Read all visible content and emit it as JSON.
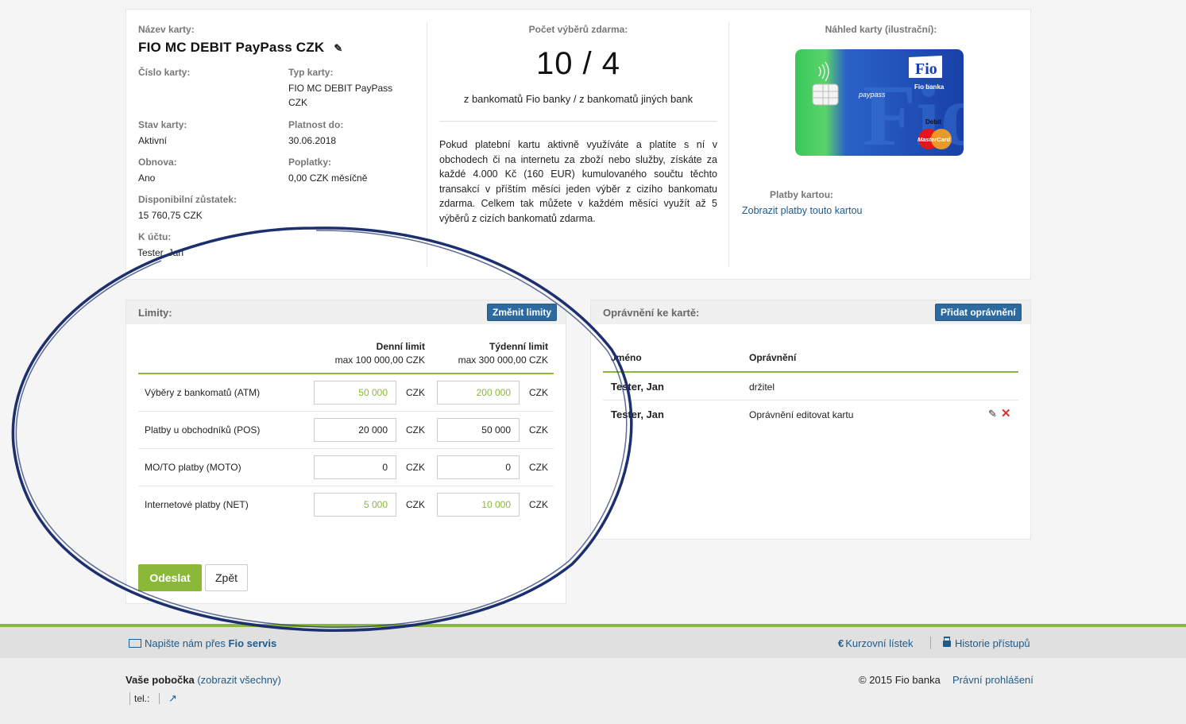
{
  "card": {
    "name_label": "Název karty:",
    "name": "FIO MC DEBIT PayPass CZK",
    "number_label": "Číslo karty:",
    "type_label": "Typ karty:",
    "type_value": "FIO MC DEBIT PayPass CZK",
    "state_label": "Stav karty:",
    "state_value": "Aktivní",
    "validity_label": "Platnost do:",
    "validity_value": "30.06.2018",
    "renewal_label": "Obnova:",
    "renewal_value": "Ano",
    "fees_label": "Poplatky:",
    "fees_value": "0,00 CZK měsíčně",
    "balance_label": "Disponibilní zůstatek:",
    "balance_value": "15 760,75 CZK",
    "account_label": "K účtu:",
    "account_value": "Tester, Jan"
  },
  "withdrawals": {
    "label": "Počet výběrů zdarma:",
    "count": "10 / 4",
    "sub": "z bankomatů Fio banky / z bankomatů jiných bank",
    "info": "Pokud platební kartu aktivně využíváte a platíte s ní v obchodech či na internetu za zboží nebo služby, získáte za každé 4.000 Kč (160 EUR) kumulovaného součtu těchto transakcí v příštím měsíci jeden výběr z cizího bankomatu zdarma. Celkem tak můžete v každém měsíci využít až 5 výběrů z cizích bankomatů zdarma."
  },
  "preview": {
    "label": "Náhled karty (ilustrační):",
    "card_brand": "Fio",
    "card_bank": "Fio banka",
    "card_paypass": "paypass",
    "card_debit": "Debit",
    "card_mastercard": "MasterCard",
    "payments_label": "Platby kartou:",
    "payments_link": "Zobrazit platby touto kartou"
  },
  "limits": {
    "title": "Limity:",
    "change_button": "Změnit limity",
    "daily_header": "Denní limit",
    "daily_max": "max 100 000,00 CZK",
    "weekly_header": "Týdenní limit",
    "weekly_max": "max 300 000,00 CZK",
    "currency": "CZK",
    "rows": [
      {
        "name": "Výběry z bankomatů (ATM)",
        "daily": "50 000",
        "weekly": "200 000"
      },
      {
        "name": "Platby u obchodníků (POS)",
        "daily": "20 000",
        "weekly": "50 000"
      },
      {
        "name": "MO/TO platby (MOTO)",
        "daily": "0",
        "weekly": "0"
      },
      {
        "name": "Internetové platby (NET)",
        "daily": "5 000",
        "weekly": "10 000"
      }
    ],
    "send_button": "Odeslat",
    "back_button": "Zpět"
  },
  "permissions": {
    "title": "Oprávnění ke kartě:",
    "add_button": "Přidat oprávnění",
    "col_name": "Jméno",
    "col_right": "Oprávnění",
    "rows": [
      {
        "name": "Tester, Jan",
        "right": "držitel"
      },
      {
        "name": "Tester, Jan",
        "right": "Oprávnění editovat kartu"
      }
    ]
  },
  "footer": {
    "write_prefix": "Napište nám přes",
    "write_service": "Fio servis",
    "rates": "Kurzovní lístek",
    "history": "Historie přístupů",
    "branch_label": "Vaše pobočka",
    "branch_link": "(zobrazit všechny)",
    "tel": "tel.:",
    "copyright": "© 2015 Fio banka",
    "legal": "Právní prohlášení"
  },
  "colors": {
    "accent_green": "#8cb83a",
    "button_blue": "#2c6aa0",
    "link_blue": "#1e5a8a",
    "annotation": "#1c2f6e"
  }
}
